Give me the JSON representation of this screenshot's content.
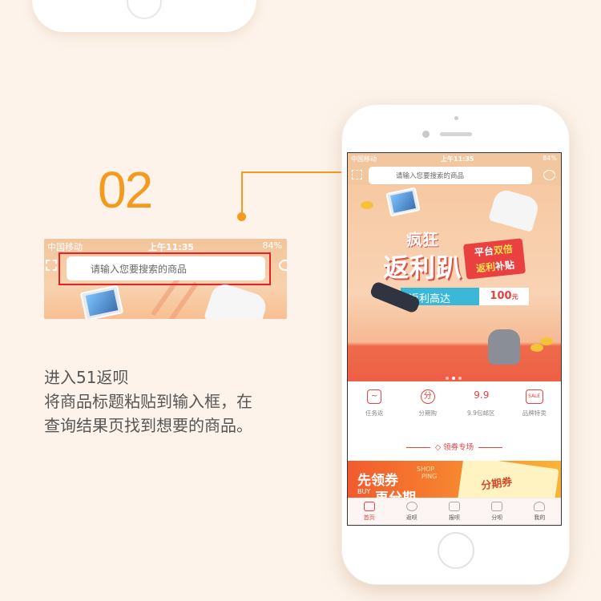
{
  "step": {
    "number": "02"
  },
  "instructions": {
    "line1": "进入51返呗",
    "line2": "将商品标题粘贴到输入框，在",
    "line3": "查询结果页找到想要的商品。"
  },
  "zoom": {
    "carrier": "中国移动",
    "time": "上午11:35",
    "battery": "84%",
    "search_placeholder": "请输入您要搜索的商品"
  },
  "app": {
    "status": {
      "carrier": "中国移动",
      "time": "上午11:35",
      "battery": "84%"
    },
    "search_placeholder": "请输入您要搜索的商品",
    "banner": {
      "title_top": "疯狂",
      "title_main": "返利趴",
      "tag_line1_a": "平台",
      "tag_line1_b": "双倍",
      "tag_line2_a": "返利",
      "tag_line2_b": "补贴",
      "pill": "返利高达",
      "price": "100",
      "price_unit": "元"
    },
    "nav": [
      {
        "label": "任务返",
        "icon": "task-icon",
        "glyph": "~"
      },
      {
        "label": "分期购",
        "icon": "installment-icon",
        "glyph": "分"
      },
      {
        "label": "9.9包邮区",
        "icon": "nine-nine-icon",
        "glyph": "9.9"
      },
      {
        "label": "品牌特卖",
        "icon": "sale-icon",
        "glyph": "SALE"
      }
    ],
    "section_title": "领券专场",
    "promo": {
      "text1": "先领券",
      "shop": "SHOP",
      "ping": "PING",
      "buy": "BUY",
      "text2": "再分期",
      "card_label": "分期券"
    },
    "tabs": [
      {
        "label": "首页",
        "icon": "home-icon"
      },
      {
        "label": "返呗",
        "icon": "piggy-icon"
      },
      {
        "label": "报呗",
        "icon": "gift-icon"
      },
      {
        "label": "分呗",
        "icon": "card-icon"
      },
      {
        "label": "我的",
        "icon": "user-icon"
      }
    ]
  },
  "colors": {
    "accent": "#f39a1f",
    "highlight": "#e8202a",
    "brand_red": "#e8413f"
  }
}
